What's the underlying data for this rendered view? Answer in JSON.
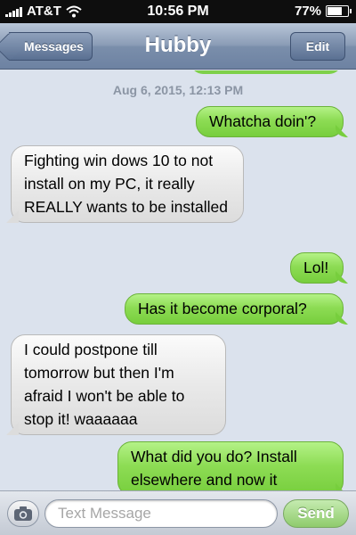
{
  "status_bar": {
    "carrier": "AT&T",
    "time": "10:56 PM",
    "battery": "77%",
    "battery_level": 0.77
  },
  "nav": {
    "back_label": "Messages",
    "title": "Hubby",
    "edit_label": "Edit"
  },
  "thread": {
    "timestamp": "Aug 6, 2015, 12:13 PM",
    "messages": [
      {
        "direction": "out",
        "text": "Whatcha doin'?"
      },
      {
        "direction": "in",
        "text": "Fighting win dows 10 to not install on my PC, it really REALLY wants to be installed"
      },
      {
        "direction": "out",
        "text": "Lol!"
      },
      {
        "direction": "out",
        "text": "Has it become corporal?"
      },
      {
        "direction": "in",
        "text": "I could postpone till tomorrow but then I'm afraid I won't be able to stop it! waaaaaa"
      },
      {
        "direction": "out",
        "text": "What did you do? Install elsewhere and now it"
      }
    ]
  },
  "input_bar": {
    "placeholder": "Text Message",
    "send_label": "Send"
  },
  "colors": {
    "outgoing_bubble": "#8ddc54",
    "incoming_bubble": "#e9e9e9",
    "nav_bar": "#7a8eab"
  },
  "icons": {
    "signal": "signal-bars-icon",
    "wifi": "wifi-icon",
    "battery": "battery-icon",
    "back": "back-chevron-icon",
    "camera": "camera-icon"
  }
}
